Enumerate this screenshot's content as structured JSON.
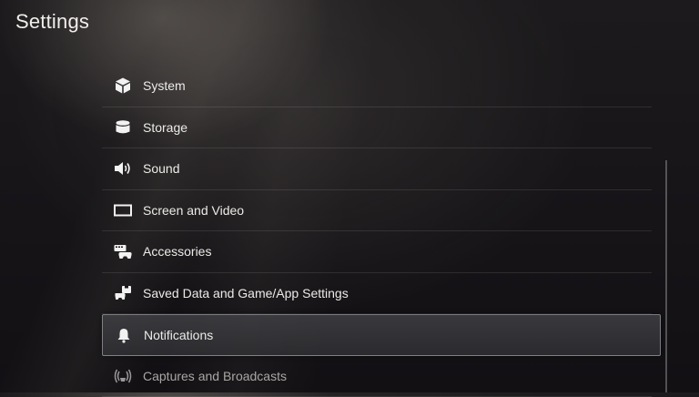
{
  "page": {
    "title": "Settings"
  },
  "menu": {
    "items": [
      {
        "label": "System",
        "icon": "system-cube-icon",
        "selected": false
      },
      {
        "label": "Storage",
        "icon": "storage-cylinder-icon",
        "selected": false
      },
      {
        "label": "Sound",
        "icon": "speaker-icon",
        "selected": false
      },
      {
        "label": "Screen and Video",
        "icon": "screen-icon",
        "selected": false
      },
      {
        "label": "Accessories",
        "icon": "accessories-icon",
        "selected": false
      },
      {
        "label": "Saved Data and Game/App Settings",
        "icon": "saved-data-icon",
        "selected": false
      },
      {
        "label": "Notifications",
        "icon": "bell-icon",
        "selected": true
      },
      {
        "label": "Captures and Broadcasts",
        "icon": "broadcast-icon",
        "selected": false
      }
    ]
  }
}
